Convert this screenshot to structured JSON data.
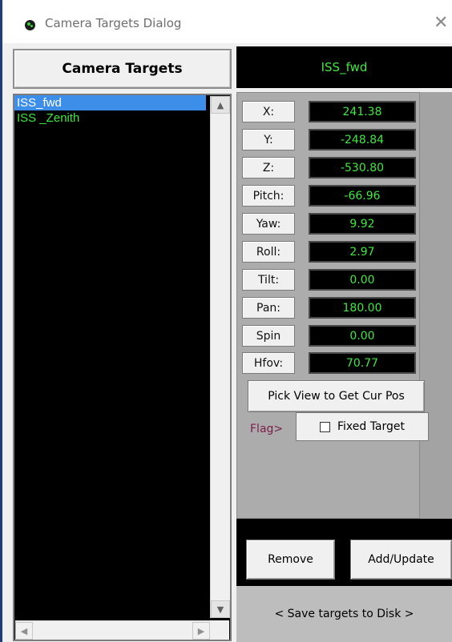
{
  "window": {
    "title": "Camera Targets Dialog",
    "close_glyph": "✕",
    "icon": "green-dot-app-icon"
  },
  "targets_header": "Camera Targets",
  "selected_name": "ISS_fwd",
  "targets": [
    {
      "label": "ISS_fwd",
      "selected": true
    },
    {
      "label": "ISS _Zenith",
      "selected": false
    }
  ],
  "fields": [
    {
      "label": "X:",
      "value": "241.38"
    },
    {
      "label": "Y:",
      "value": "-248.84"
    },
    {
      "label": "Z:",
      "value": "-530.80"
    },
    {
      "label": "Pitch:",
      "value": "-66.96"
    },
    {
      "label": "Yaw:",
      "value": "9.92"
    },
    {
      "label": "Roll:",
      "value": "2.97"
    },
    {
      "label": "Tilt:",
      "value": "0.00"
    },
    {
      "label": "Pan:",
      "value": "180.00"
    },
    {
      "label": "Spin",
      "value": "0.00"
    },
    {
      "label": "Hfov:",
      "value": "70.77"
    }
  ],
  "pick_button": "Pick View to Get Cur Pos",
  "flag_label": "Flag>",
  "fixed_target": {
    "label": "Fixed Target",
    "checked": false
  },
  "remove_button": "Remove",
  "add_update_button": "Add/Update",
  "save_button": "< Save targets to Disk >",
  "colors": {
    "value_text": "#3ee83e",
    "selection": "#3d8ee8",
    "flag_text": "#7a1f4a"
  }
}
